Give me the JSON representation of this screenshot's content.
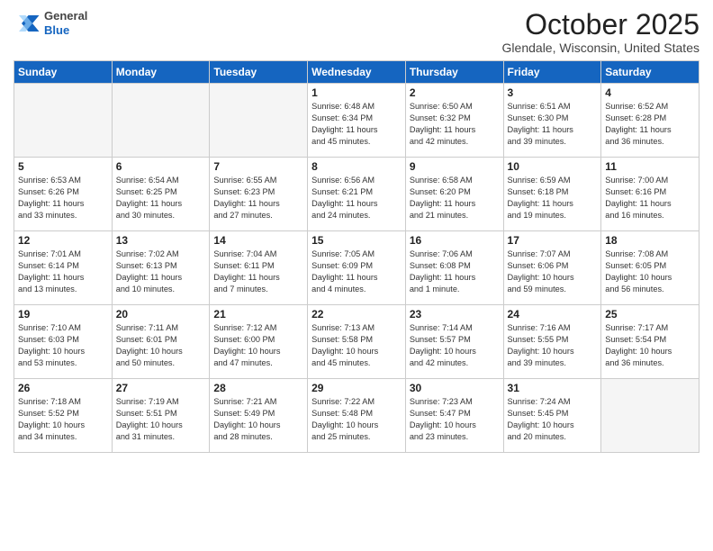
{
  "header": {
    "logo_general": "General",
    "logo_blue": "Blue",
    "month_title": "October 2025",
    "location": "Glendale, Wisconsin, United States"
  },
  "days_of_week": [
    "Sunday",
    "Monday",
    "Tuesday",
    "Wednesday",
    "Thursday",
    "Friday",
    "Saturday"
  ],
  "weeks": [
    [
      {
        "day": "",
        "info": ""
      },
      {
        "day": "",
        "info": ""
      },
      {
        "day": "",
        "info": ""
      },
      {
        "day": "1",
        "info": "Sunrise: 6:48 AM\nSunset: 6:34 PM\nDaylight: 11 hours\nand 45 minutes."
      },
      {
        "day": "2",
        "info": "Sunrise: 6:50 AM\nSunset: 6:32 PM\nDaylight: 11 hours\nand 42 minutes."
      },
      {
        "day": "3",
        "info": "Sunrise: 6:51 AM\nSunset: 6:30 PM\nDaylight: 11 hours\nand 39 minutes."
      },
      {
        "day": "4",
        "info": "Sunrise: 6:52 AM\nSunset: 6:28 PM\nDaylight: 11 hours\nand 36 minutes."
      }
    ],
    [
      {
        "day": "5",
        "info": "Sunrise: 6:53 AM\nSunset: 6:26 PM\nDaylight: 11 hours\nand 33 minutes."
      },
      {
        "day": "6",
        "info": "Sunrise: 6:54 AM\nSunset: 6:25 PM\nDaylight: 11 hours\nand 30 minutes."
      },
      {
        "day": "7",
        "info": "Sunrise: 6:55 AM\nSunset: 6:23 PM\nDaylight: 11 hours\nand 27 minutes."
      },
      {
        "day": "8",
        "info": "Sunrise: 6:56 AM\nSunset: 6:21 PM\nDaylight: 11 hours\nand 24 minutes."
      },
      {
        "day": "9",
        "info": "Sunrise: 6:58 AM\nSunset: 6:20 PM\nDaylight: 11 hours\nand 21 minutes."
      },
      {
        "day": "10",
        "info": "Sunrise: 6:59 AM\nSunset: 6:18 PM\nDaylight: 11 hours\nand 19 minutes."
      },
      {
        "day": "11",
        "info": "Sunrise: 7:00 AM\nSunset: 6:16 PM\nDaylight: 11 hours\nand 16 minutes."
      }
    ],
    [
      {
        "day": "12",
        "info": "Sunrise: 7:01 AM\nSunset: 6:14 PM\nDaylight: 11 hours\nand 13 minutes."
      },
      {
        "day": "13",
        "info": "Sunrise: 7:02 AM\nSunset: 6:13 PM\nDaylight: 11 hours\nand 10 minutes."
      },
      {
        "day": "14",
        "info": "Sunrise: 7:04 AM\nSunset: 6:11 PM\nDaylight: 11 hours\nand 7 minutes."
      },
      {
        "day": "15",
        "info": "Sunrise: 7:05 AM\nSunset: 6:09 PM\nDaylight: 11 hours\nand 4 minutes."
      },
      {
        "day": "16",
        "info": "Sunrise: 7:06 AM\nSunset: 6:08 PM\nDaylight: 11 hours\nand 1 minute."
      },
      {
        "day": "17",
        "info": "Sunrise: 7:07 AM\nSunset: 6:06 PM\nDaylight: 10 hours\nand 59 minutes."
      },
      {
        "day": "18",
        "info": "Sunrise: 7:08 AM\nSunset: 6:05 PM\nDaylight: 10 hours\nand 56 minutes."
      }
    ],
    [
      {
        "day": "19",
        "info": "Sunrise: 7:10 AM\nSunset: 6:03 PM\nDaylight: 10 hours\nand 53 minutes."
      },
      {
        "day": "20",
        "info": "Sunrise: 7:11 AM\nSunset: 6:01 PM\nDaylight: 10 hours\nand 50 minutes."
      },
      {
        "day": "21",
        "info": "Sunrise: 7:12 AM\nSunset: 6:00 PM\nDaylight: 10 hours\nand 47 minutes."
      },
      {
        "day": "22",
        "info": "Sunrise: 7:13 AM\nSunset: 5:58 PM\nDaylight: 10 hours\nand 45 minutes."
      },
      {
        "day": "23",
        "info": "Sunrise: 7:14 AM\nSunset: 5:57 PM\nDaylight: 10 hours\nand 42 minutes."
      },
      {
        "day": "24",
        "info": "Sunrise: 7:16 AM\nSunset: 5:55 PM\nDaylight: 10 hours\nand 39 minutes."
      },
      {
        "day": "25",
        "info": "Sunrise: 7:17 AM\nSunset: 5:54 PM\nDaylight: 10 hours\nand 36 minutes."
      }
    ],
    [
      {
        "day": "26",
        "info": "Sunrise: 7:18 AM\nSunset: 5:52 PM\nDaylight: 10 hours\nand 34 minutes."
      },
      {
        "day": "27",
        "info": "Sunrise: 7:19 AM\nSunset: 5:51 PM\nDaylight: 10 hours\nand 31 minutes."
      },
      {
        "day": "28",
        "info": "Sunrise: 7:21 AM\nSunset: 5:49 PM\nDaylight: 10 hours\nand 28 minutes."
      },
      {
        "day": "29",
        "info": "Sunrise: 7:22 AM\nSunset: 5:48 PM\nDaylight: 10 hours\nand 25 minutes."
      },
      {
        "day": "30",
        "info": "Sunrise: 7:23 AM\nSunset: 5:47 PM\nDaylight: 10 hours\nand 23 minutes."
      },
      {
        "day": "31",
        "info": "Sunrise: 7:24 AM\nSunset: 5:45 PM\nDaylight: 10 hours\nand 20 minutes."
      },
      {
        "day": "",
        "info": ""
      }
    ]
  ]
}
